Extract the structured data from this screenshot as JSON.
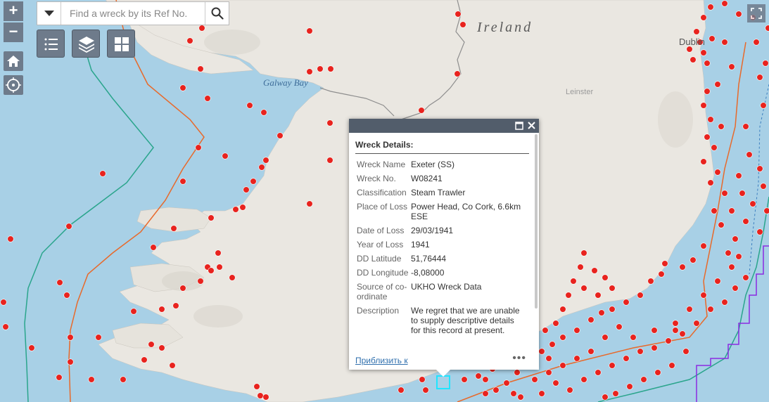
{
  "search": {
    "placeholder": "Find a wreck by its Ref No."
  },
  "map_labels": {
    "country": "Ireland",
    "bay": "Galway Bay",
    "province": "Leinster",
    "city": "Dublin"
  },
  "popup": {
    "title": "Wreck Details:",
    "rows": [
      {
        "label": "Wreck Name",
        "value": "Exeter (SS)"
      },
      {
        "label": "Wreck No.",
        "value": "W08241"
      },
      {
        "label": "Classification",
        "value": "Steam Trawler"
      },
      {
        "label": "Place of Loss",
        "value": "Power Head, Co Cork, 6.6km ESE"
      },
      {
        "label": "Date of Loss",
        "value": "29/03/1941"
      },
      {
        "label": "Year of Loss",
        "value": "1941"
      },
      {
        "label": "DD Latitude",
        "value": "51,76444"
      },
      {
        "label": "DD Longitude",
        "value": "-8,08000"
      },
      {
        "label": "Source of co-ordinate",
        "value": "UKHO Wreck Data"
      },
      {
        "label": "Description",
        "value": "We regret that we are unable to supply descriptive details for this record at present."
      }
    ],
    "zoom_link": "Приблизить к",
    "more": "•••"
  },
  "controls": {
    "zoom_in": "+",
    "zoom_out": "−"
  },
  "colors": {
    "sea": "#a8d0e6",
    "land": "#eae7e1",
    "wreck_marker": "#e8231e",
    "orange_line": "#e8692a",
    "teal_line": "#2aa58c",
    "purple_line": "#8a2be2",
    "button": "#6e7b8b"
  }
}
